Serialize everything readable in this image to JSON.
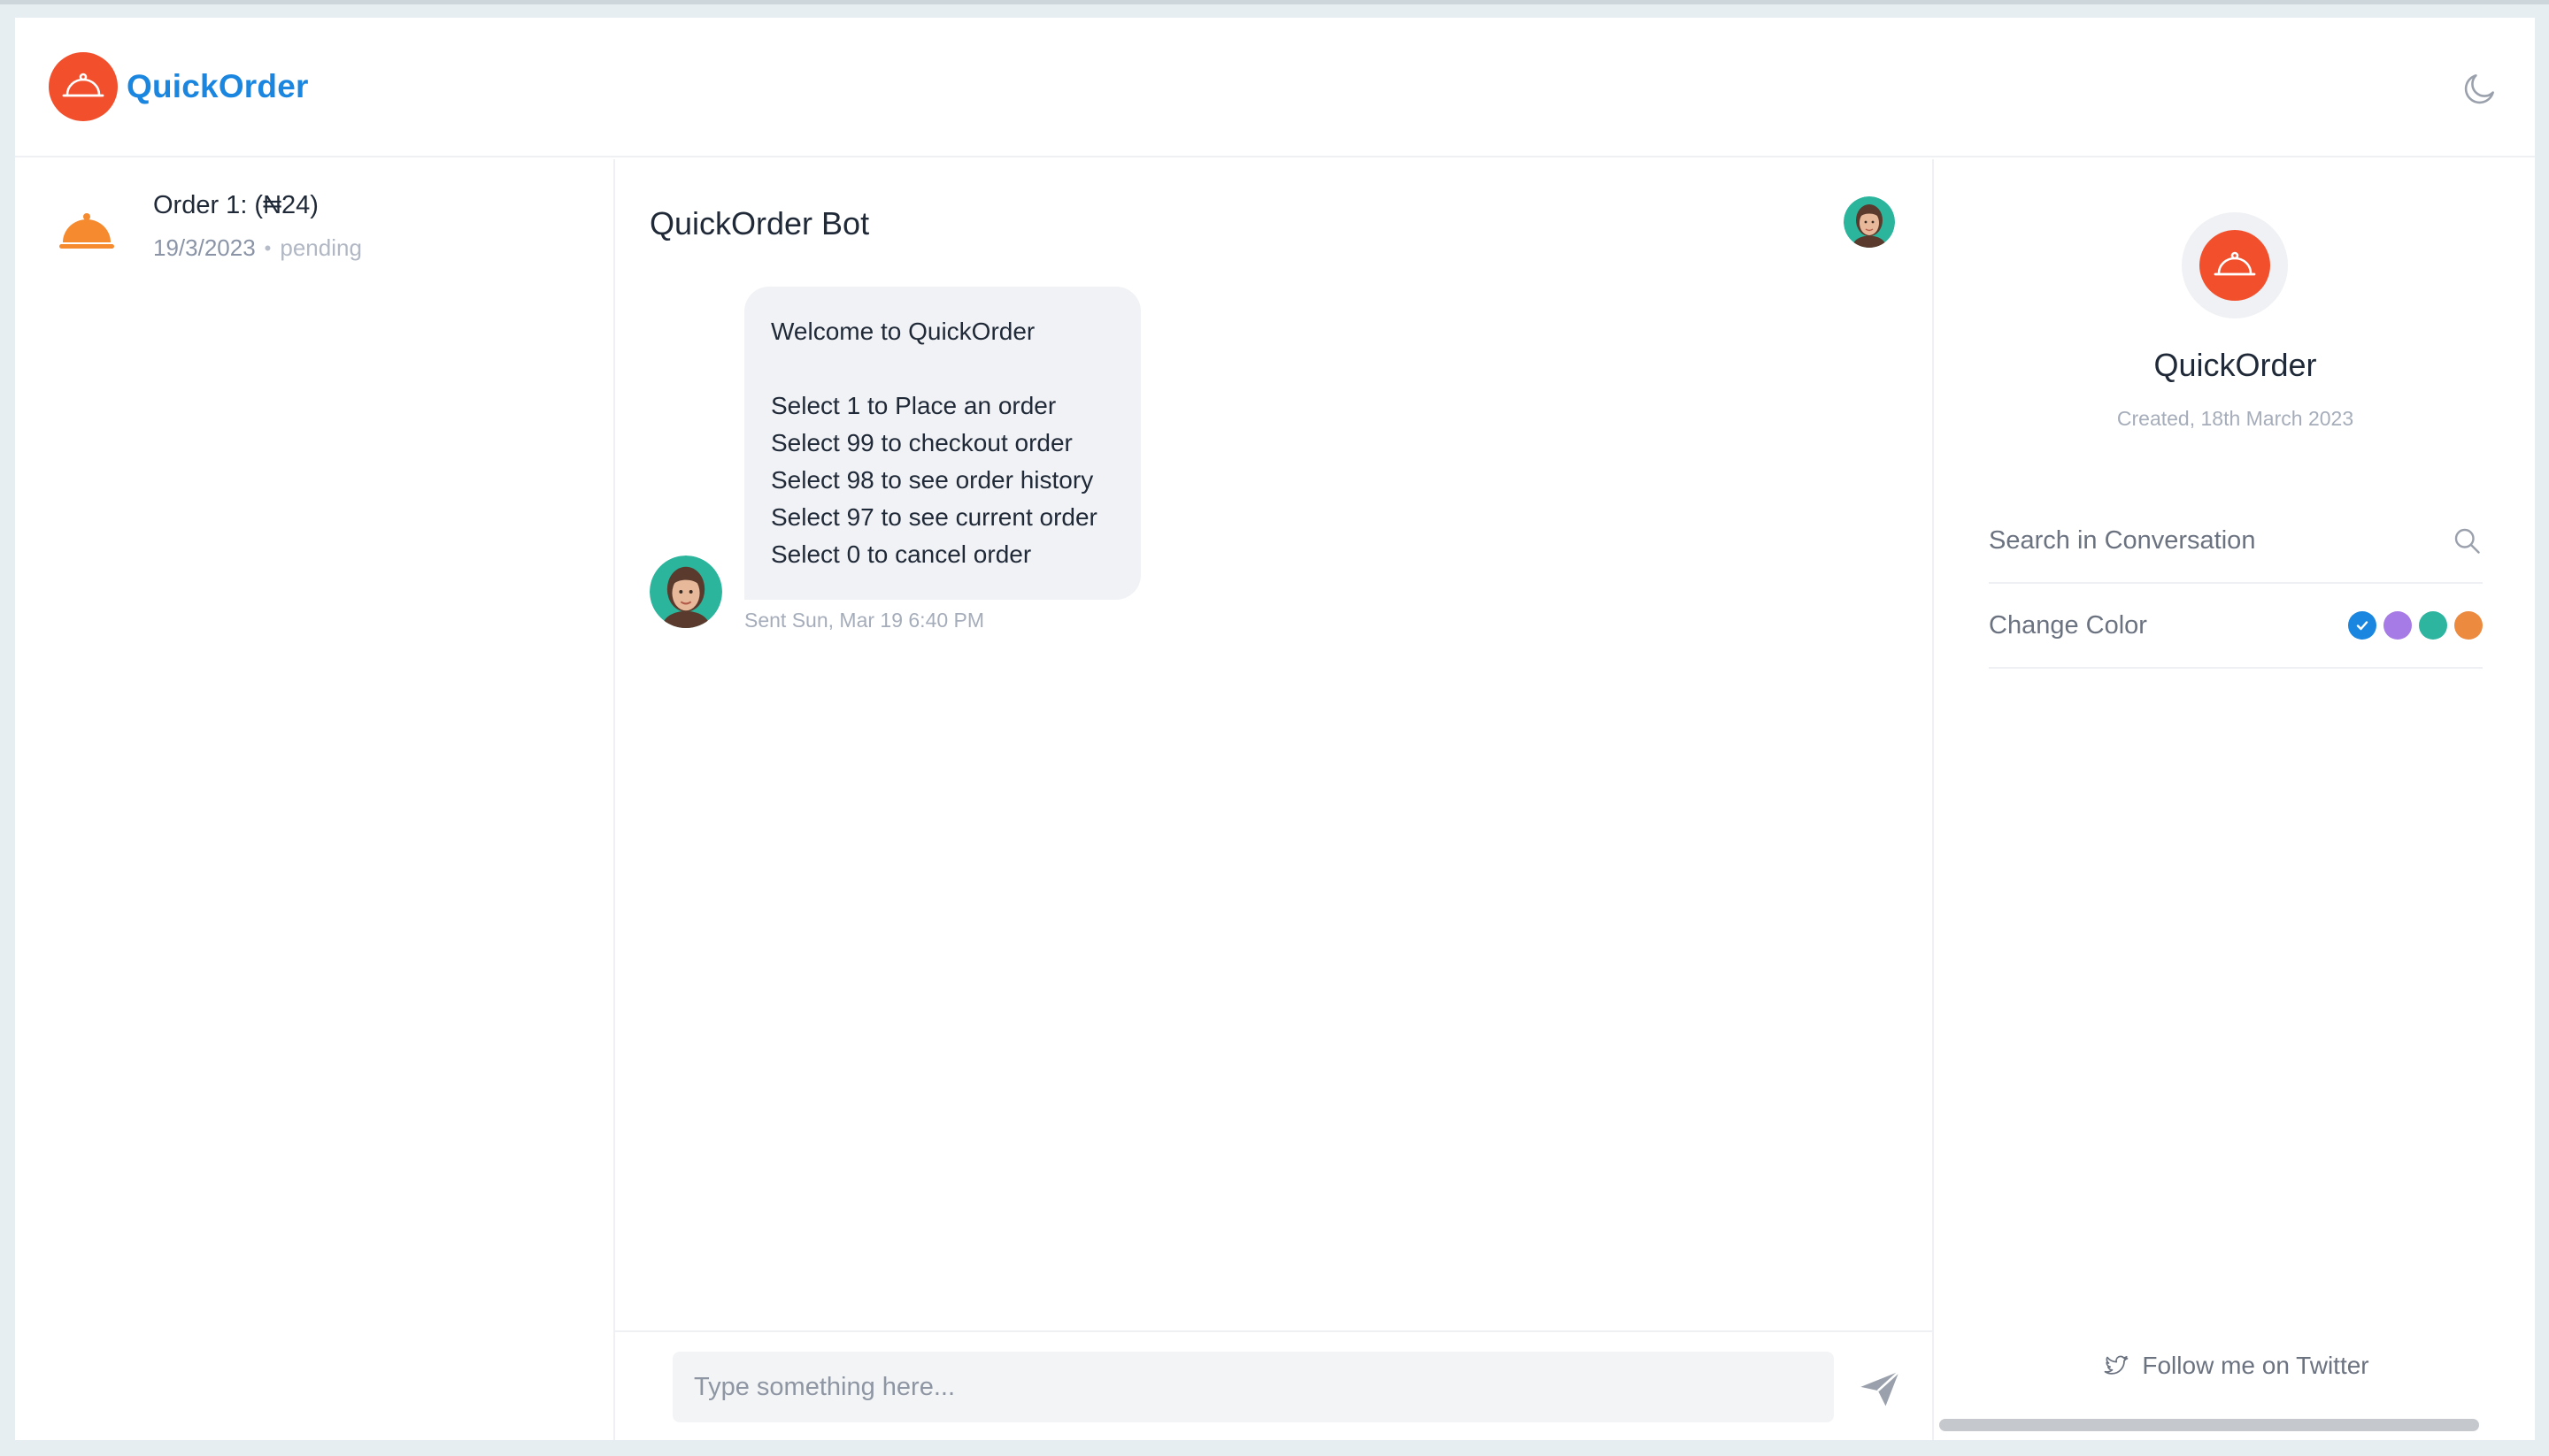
{
  "app": {
    "name": "QuickOrder",
    "brand_color": "#1a86e0",
    "logo_color": "#f2502d"
  },
  "header": {
    "theme_toggle_icon": "moon-icon"
  },
  "orders": [
    {
      "title": "Order 1: (₦24)",
      "date": "19/3/2023",
      "separator": "•",
      "status": "pending",
      "icon": "food-cloche-icon"
    }
  ],
  "chat": {
    "title": "QuickOrder Bot",
    "messages": [
      {
        "lines": [
          "Welcome to QuickOrder",
          "Select 1 to Place an order",
          "Select 99 to checkout order",
          "Select 98 to see order history",
          "Select 97 to see current order",
          "Select 0 to cancel order"
        ],
        "time": "Sent Sun, Mar 19 6:40 PM"
      }
    ],
    "composer": {
      "placeholder": "Type something here...",
      "value": ""
    }
  },
  "profile": {
    "name": "QuickOrder",
    "created": "Created, 18th March 2023",
    "search_label": "Search in Conversation",
    "color_label": "Change Color",
    "colors": [
      "#1a86e0",
      "#a77be6",
      "#2eb5a0",
      "#ec8a3f"
    ],
    "selected_color": "#1a86e0",
    "twitter_label": "Follow me on Twitter"
  }
}
